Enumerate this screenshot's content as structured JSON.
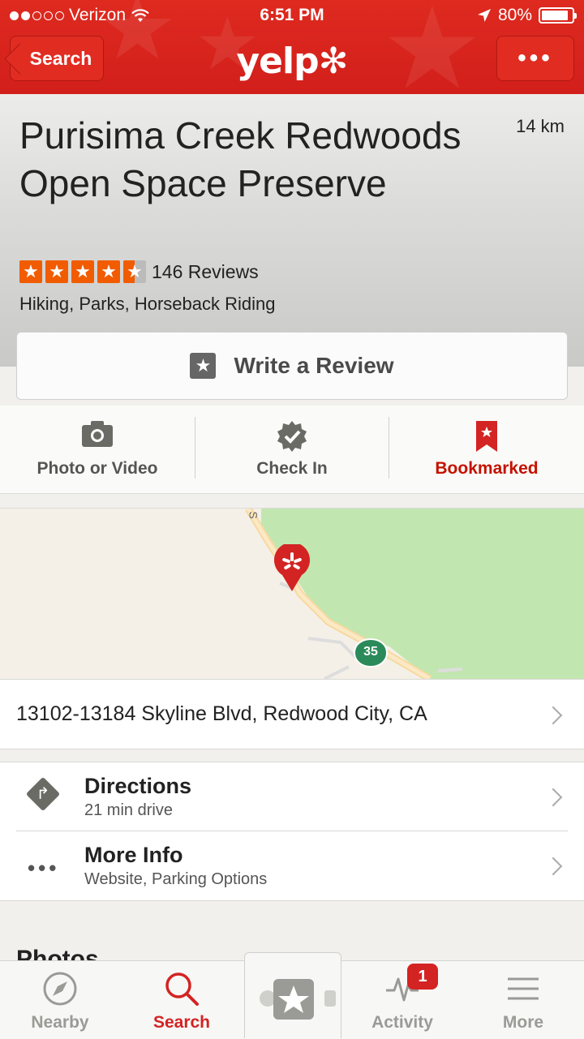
{
  "status_bar": {
    "carrier": "Verizon",
    "time": "6:51 PM",
    "battery": "80%",
    "battery_level": 0.8,
    "signal_bars_filled": 2,
    "signal_bars_total": 5
  },
  "header": {
    "back_label": "Search",
    "logo": "yelp",
    "more_label": "•••"
  },
  "business": {
    "name": "Purisima Creek Redwoods Open Space Preserve",
    "distance": "14 km",
    "rating": 4.5,
    "reviews": "146 Reviews",
    "categories": "Hiking, Parks, Horseback Riding"
  },
  "write_review": {
    "label": "Write a Review"
  },
  "actions": [
    {
      "label": "Photo or Video",
      "icon": "camera-icon"
    },
    {
      "label": "Check In",
      "icon": "check-badge-icon"
    },
    {
      "label": "Bookmarked",
      "icon": "bookmark-icon"
    }
  ],
  "map": {
    "road_label": "S",
    "route_number": "35"
  },
  "address": "13102-13184 Skyline Blvd, Redwood City, CA",
  "info": {
    "directions_title": "Directions",
    "directions_sub": "21 min drive",
    "more_info_title": "More Info",
    "more_info_sub": "Website, Parking Options"
  },
  "photos_title": "Photos",
  "tabs": [
    {
      "label": "Nearby",
      "icon": "compass-icon"
    },
    {
      "label": "Search",
      "icon": "search-icon"
    },
    {
      "label": "",
      "icon": "add-review-icon"
    },
    {
      "label": "Activity",
      "icon": "activity-icon",
      "badge": "1"
    },
    {
      "label": "More",
      "icon": "menu-icon"
    }
  ],
  "colors": {
    "brand": "#d32323",
    "star": "#f15c00",
    "map_green": "#c2e6b0"
  }
}
